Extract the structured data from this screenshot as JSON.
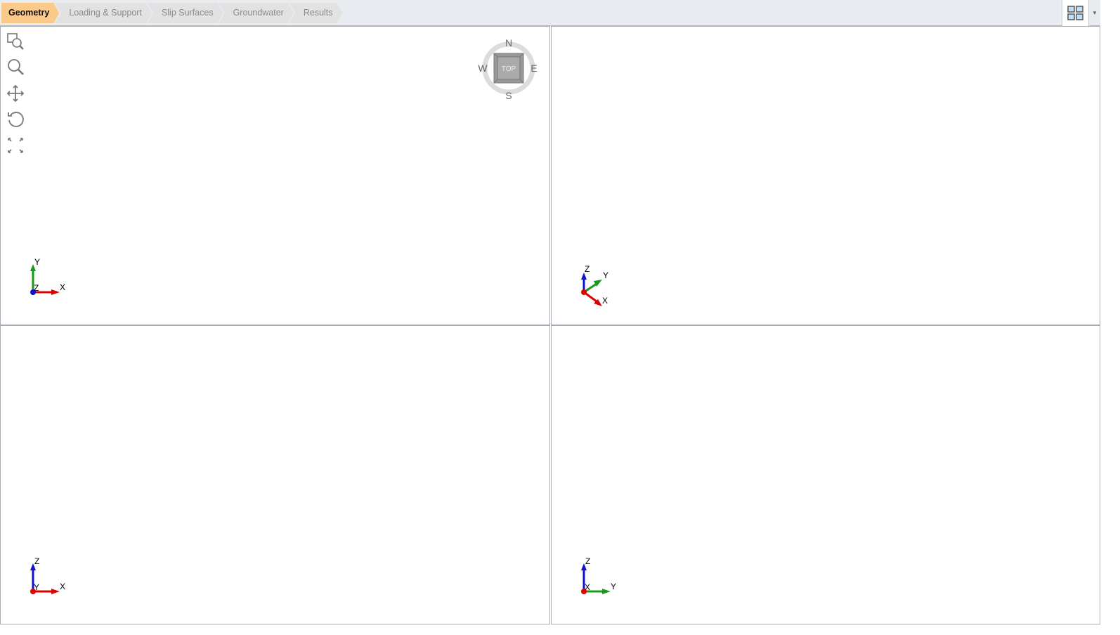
{
  "tabs": [
    {
      "label": "Geometry",
      "active": true
    },
    {
      "label": "Loading & Support"
    },
    {
      "label": "Slip Surfaces"
    },
    {
      "label": "Groundwater"
    },
    {
      "label": "Results"
    }
  ],
  "layout_button": {
    "icon": "four-viewports-icon"
  },
  "toolbar": {
    "icons": [
      "zoom-window-icon",
      "zoom-icon",
      "pan-icon",
      "rotate-icon",
      "zoom-extents-icon"
    ]
  },
  "compass": {
    "n": "N",
    "s": "S",
    "e": "E",
    "w": "W",
    "face": "TOP"
  },
  "viewports": {
    "top": {
      "axes": {
        "a": "Y",
        "b": "X",
        "c": "Z"
      }
    },
    "perspective": {
      "axes": {
        "a": "Z",
        "b": "Y",
        "c": "X"
      }
    },
    "front": {
      "axes": {
        "a": "Z",
        "b": "X",
        "c": "Y"
      }
    },
    "side": {
      "axes": {
        "a": "Z",
        "b": "Y",
        "c": "X"
      }
    }
  },
  "colors": {
    "active_tab": "#fbc98a",
    "x_axis": "#e00000",
    "y_axis": "#1a9a1a",
    "z_axis": "#1010d0"
  }
}
